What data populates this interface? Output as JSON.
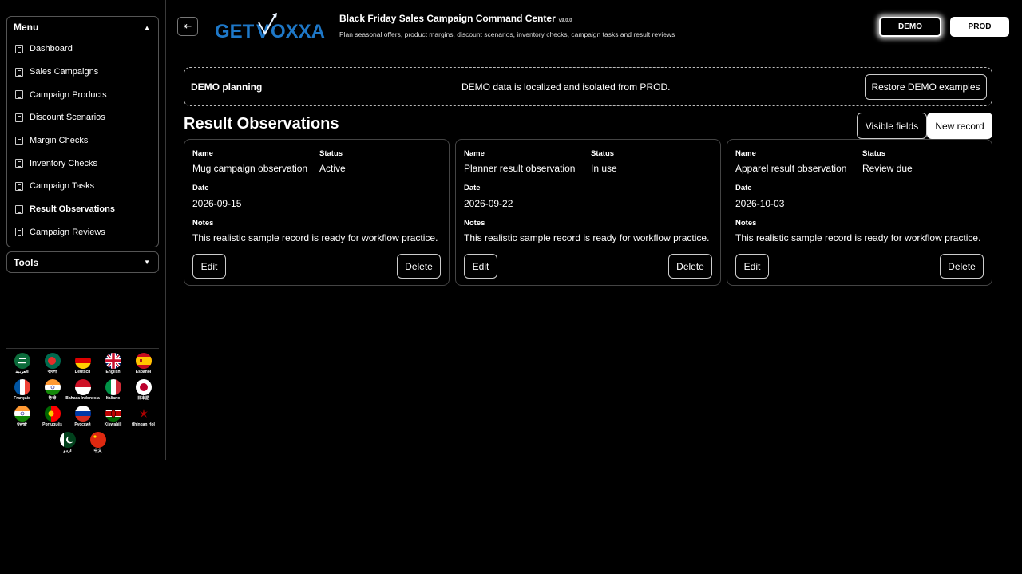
{
  "sidebar": {
    "menu_title": "Menu",
    "items": [
      {
        "label": "Dashboard"
      },
      {
        "label": "Sales Campaigns"
      },
      {
        "label": "Campaign Products"
      },
      {
        "label": "Discount Scenarios"
      },
      {
        "label": "Margin Checks"
      },
      {
        "label": "Inventory Checks"
      },
      {
        "label": "Campaign Tasks"
      },
      {
        "label": "Result Observations",
        "active": true
      },
      {
        "label": "Campaign Reviews"
      }
    ],
    "tools_title": "Tools",
    "languages": [
      {
        "name": "العربية"
      },
      {
        "name": "বাংলা"
      },
      {
        "name": "Deutsch"
      },
      {
        "name": "English"
      },
      {
        "name": "Español"
      },
      {
        "name": "Français"
      },
      {
        "name": "हिन्दी"
      },
      {
        "name": "Bahasa Indonesia"
      },
      {
        "name": "Italiano"
      },
      {
        "name": "日本語"
      },
      {
        "name": "ਪੰਜਾਬੀ"
      },
      {
        "name": "Português"
      },
      {
        "name": "Русский"
      },
      {
        "name": "Kiswahili"
      },
      {
        "name": "tlhIngan Hol"
      },
      {
        "name": "اردو"
      },
      {
        "name": "中文"
      }
    ]
  },
  "header": {
    "logo_text": "GETVOXXA",
    "title": "Black Friday Sales Campaign Command Center",
    "version": "v9.0.0",
    "subtitle": "Plan seasonal offers, product margins, discount scenarios, inventory checks, campaign tasks and result reviews",
    "env_demo": "DEMO",
    "env_prod": "PROD"
  },
  "banner": {
    "title": "DEMO planning",
    "message": "DEMO data is localized and isolated from PROD.",
    "restore_label": "Restore DEMO examples"
  },
  "page": {
    "title": "Result Observations",
    "visible_fields_label": "Visible fields",
    "new_record_label": "New record"
  },
  "fields": {
    "name": "Name",
    "status": "Status",
    "date": "Date",
    "notes": "Notes",
    "edit": "Edit",
    "delete": "Delete"
  },
  "records": [
    {
      "name": "Mug campaign observation",
      "status": "Active",
      "date": "2026-09-15",
      "notes": "This realistic sample record is ready for workflow practice."
    },
    {
      "name": "Planner result observation",
      "status": "In use",
      "date": "2026-09-22",
      "notes": "This realistic sample record is ready for workflow practice."
    },
    {
      "name": "Apparel result observation",
      "status": "Review due",
      "date": "2026-10-03",
      "notes": "This realistic sample record is ready for workflow practice."
    }
  ],
  "colors": {
    "background": "#000000",
    "accent_blue": "#1e78c8"
  }
}
